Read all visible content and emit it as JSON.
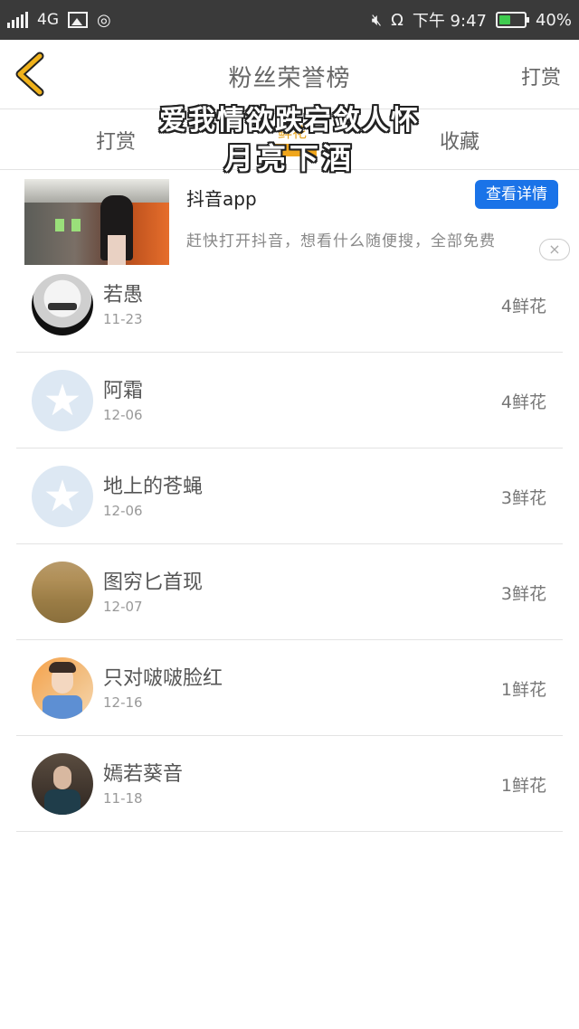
{
  "status_bar": {
    "network": "4G",
    "time": "下午 9:47",
    "battery": "40%",
    "battery_level": 0.4
  },
  "header": {
    "title": "粉丝荣誉榜",
    "right_action": "打赏"
  },
  "tabs": {
    "left": "打赏",
    "middle": "鲜花",
    "right": "收藏"
  },
  "overlay": {
    "line1": "爱我情欲跌宕敛人怀",
    "line2": "月亮下酒"
  },
  "ad": {
    "title": "抖音app",
    "button": "查看详情",
    "description": "赶快打开抖音，想看什么随便搜，全部免费",
    "close": "×"
  },
  "list": [
    {
      "name": "若愚",
      "date": "11-23",
      "flowers": "4鲜花"
    },
    {
      "name": "阿霜",
      "date": "12-06",
      "flowers": "4鲜花"
    },
    {
      "name": "地上的苍蝇",
      "date": "12-06",
      "flowers": "3鲜花"
    },
    {
      "name": "图穷匕首现",
      "date": "12-07",
      "flowers": "3鲜花"
    },
    {
      "name": "只对啵啵脸红",
      "date": "12-16",
      "flowers": "1鲜花"
    },
    {
      "name": "嫣若葵音",
      "date": "11-18",
      "flowers": "1鲜花"
    }
  ]
}
